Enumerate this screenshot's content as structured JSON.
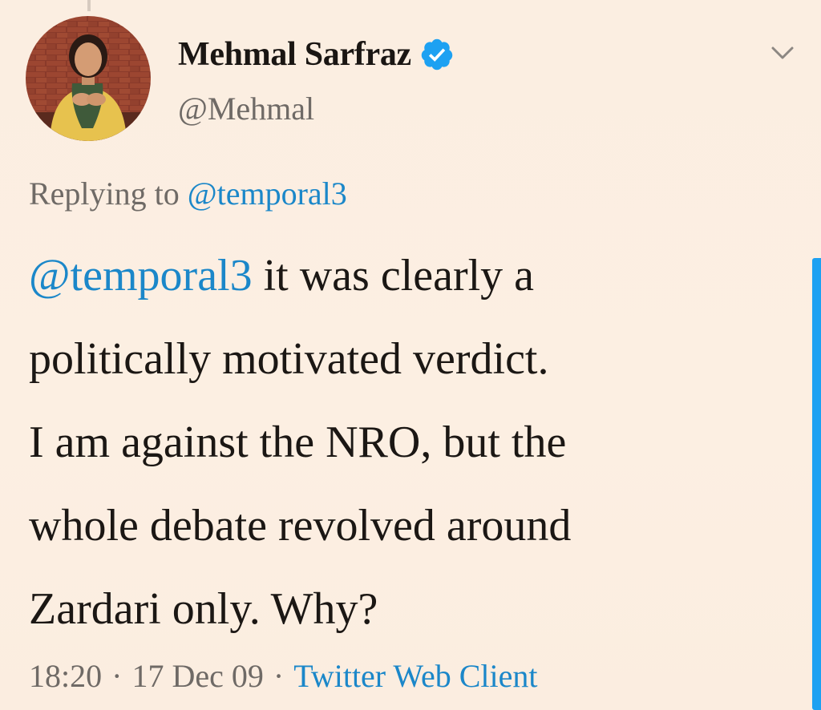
{
  "tweet": {
    "author": {
      "display_name": "Mehmal Sarfraz",
      "handle": "@Mehmal",
      "verified": true,
      "avatar_icon": "user-avatar"
    },
    "menu_icon": "chevron-down-icon",
    "replying_to": {
      "label": "Replying to",
      "handle": "@temporal3"
    },
    "text": {
      "mention": "@temporal3",
      "line1_rest": " it was clearly a",
      "line2": "politically motivated verdict.",
      "line3": "I am against the NRO, but the",
      "line4": "whole debate revolved around",
      "line5": "Zardari only. Why?"
    },
    "meta": {
      "time": "18:20",
      "date": "17 Dec 09",
      "separator": "·",
      "source": "Twitter Web Client"
    }
  },
  "colors": {
    "background": "#fbeee0",
    "link": "#1b87c9",
    "text": "#1b1714",
    "muted": "#6f6a66",
    "verified": "#1da1f2",
    "scrollbar": "#1da1f2"
  }
}
